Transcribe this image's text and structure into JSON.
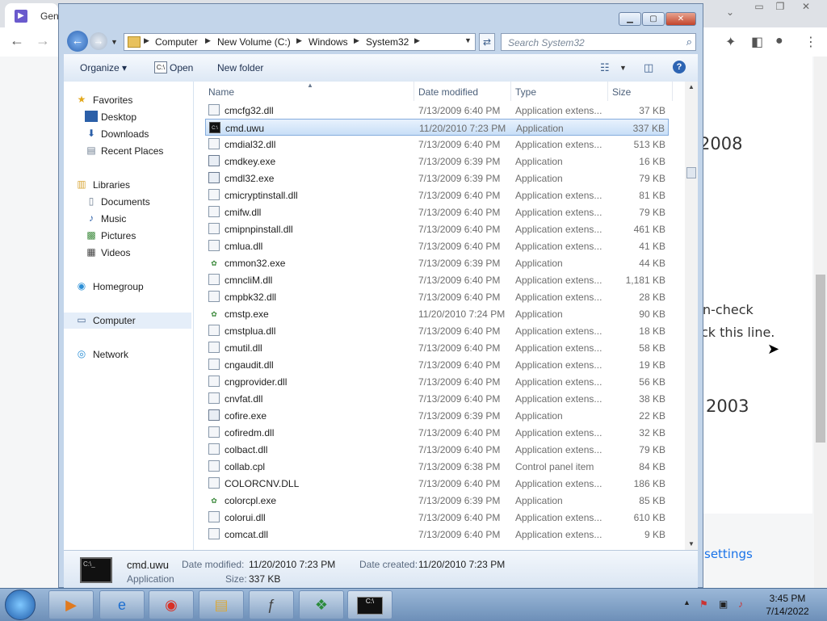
{
  "background_browser": {
    "tab_title": "Gen",
    "tab_icon": "▶",
    "page_text": {
      "heading_1": "2008",
      "line_1": "n-check",
      "line_2": "ck this line.",
      "heading_2": "2003",
      "link": "settings"
    }
  },
  "window": {
    "minimize_icon": "minimize-icon",
    "maximize_icon": "maximize-icon",
    "close_icon": "close-icon"
  },
  "address_bar": {
    "crumbs": [
      "Computer",
      "New Volume (C:)",
      "Windows",
      "System32"
    ],
    "search_placeholder": "Search System32"
  },
  "command_bar": {
    "organize": "Organize ▾",
    "open": "Open",
    "new_folder": "New folder"
  },
  "nav_pane": {
    "favorites": "Favorites",
    "desktop": "Desktop",
    "downloads": "Downloads",
    "recent_places": "Recent Places",
    "libraries": "Libraries",
    "documents": "Documents",
    "music": "Music",
    "pictures": "Pictures",
    "videos": "Videos",
    "homegroup": "Homegroup",
    "computer": "Computer",
    "network": "Network"
  },
  "columns": {
    "name": "Name",
    "date_modified": "Date modified",
    "type": "Type",
    "size": "Size"
  },
  "files": [
    {
      "name": "cmcfg32.dll",
      "date": "7/13/2009 6:40 PM",
      "type": "Application extens...",
      "size": "37 KB",
      "icon": "dll"
    },
    {
      "name": "cmd.uwu",
      "date": "11/20/2010 7:23 PM",
      "type": "Application",
      "size": "337 KB",
      "icon": "cmd",
      "selected": true
    },
    {
      "name": "cmdial32.dll",
      "date": "7/13/2009 6:40 PM",
      "type": "Application extens...",
      "size": "513 KB",
      "icon": "dll"
    },
    {
      "name": "cmdkey.exe",
      "date": "7/13/2009 6:39 PM",
      "type": "Application",
      "size": "16 KB",
      "icon": "exe"
    },
    {
      "name": "cmdl32.exe",
      "date": "7/13/2009 6:39 PM",
      "type": "Application",
      "size": "79 KB",
      "icon": "exe"
    },
    {
      "name": "cmicryptinstall.dll",
      "date": "7/13/2009 6:40 PM",
      "type": "Application extens...",
      "size": "81 KB",
      "icon": "dll"
    },
    {
      "name": "cmifw.dll",
      "date": "7/13/2009 6:40 PM",
      "type": "Application extens...",
      "size": "79 KB",
      "icon": "dll"
    },
    {
      "name": "cmipnpinstall.dll",
      "date": "7/13/2009 6:40 PM",
      "type": "Application extens...",
      "size": "461 KB",
      "icon": "dll"
    },
    {
      "name": "cmlua.dll",
      "date": "7/13/2009 6:40 PM",
      "type": "Application extens...",
      "size": "41 KB",
      "icon": "dll"
    },
    {
      "name": "cmmon32.exe",
      "date": "7/13/2009 6:39 PM",
      "type": "Application",
      "size": "44 KB",
      "icon": "app"
    },
    {
      "name": "cmncliM.dll",
      "date": "7/13/2009 6:40 PM",
      "type": "Application extens...",
      "size": "1,181 KB",
      "icon": "dll"
    },
    {
      "name": "cmpbk32.dll",
      "date": "7/13/2009 6:40 PM",
      "type": "Application extens...",
      "size": "28 KB",
      "icon": "dll"
    },
    {
      "name": "cmstp.exe",
      "date": "11/20/2010 7:24 PM",
      "type": "Application",
      "size": "90 KB",
      "icon": "app"
    },
    {
      "name": "cmstplua.dll",
      "date": "7/13/2009 6:40 PM",
      "type": "Application extens...",
      "size": "18 KB",
      "icon": "dll"
    },
    {
      "name": "cmutil.dll",
      "date": "7/13/2009 6:40 PM",
      "type": "Application extens...",
      "size": "58 KB",
      "icon": "dll"
    },
    {
      "name": "cngaudit.dll",
      "date": "7/13/2009 6:40 PM",
      "type": "Application extens...",
      "size": "19 KB",
      "icon": "dll"
    },
    {
      "name": "cngprovider.dll",
      "date": "7/13/2009 6:40 PM",
      "type": "Application extens...",
      "size": "56 KB",
      "icon": "dll"
    },
    {
      "name": "cnvfat.dll",
      "date": "7/13/2009 6:40 PM",
      "type": "Application extens...",
      "size": "38 KB",
      "icon": "dll"
    },
    {
      "name": "cofire.exe",
      "date": "7/13/2009 6:39 PM",
      "type": "Application",
      "size": "22 KB",
      "icon": "exe"
    },
    {
      "name": "cofiredm.dll",
      "date": "7/13/2009 6:40 PM",
      "type": "Application extens...",
      "size": "32 KB",
      "icon": "dll"
    },
    {
      "name": "colbact.dll",
      "date": "7/13/2009 6:40 PM",
      "type": "Application extens...",
      "size": "79 KB",
      "icon": "dll"
    },
    {
      "name": "collab.cpl",
      "date": "7/13/2009 6:38 PM",
      "type": "Control panel item",
      "size": "84 KB",
      "icon": "dll"
    },
    {
      "name": "COLORCNV.DLL",
      "date": "7/13/2009 6:40 PM",
      "type": "Application extens...",
      "size": "186 KB",
      "icon": "dll"
    },
    {
      "name": "colorcpl.exe",
      "date": "7/13/2009 6:39 PM",
      "type": "Application",
      "size": "85 KB",
      "icon": "app"
    },
    {
      "name": "colorui.dll",
      "date": "7/13/2009 6:40 PM",
      "type": "Application extens...",
      "size": "610 KB",
      "icon": "dll"
    },
    {
      "name": "comcat.dll",
      "date": "7/13/2009 6:40 PM",
      "type": "Application extens...",
      "size": "9 KB",
      "icon": "dll"
    }
  ],
  "details": {
    "name": "cmd.uwu",
    "type": "Application",
    "date_modified_label": "Date modified:",
    "date_modified": "11/20/2010 7:23 PM",
    "date_created_label": "Date created:",
    "date_created": "11/20/2010 7:23 PM",
    "size_label": "Size:",
    "size": "337 KB"
  },
  "taskbar": {
    "time": "3:45 PM",
    "date": "7/14/2022"
  }
}
